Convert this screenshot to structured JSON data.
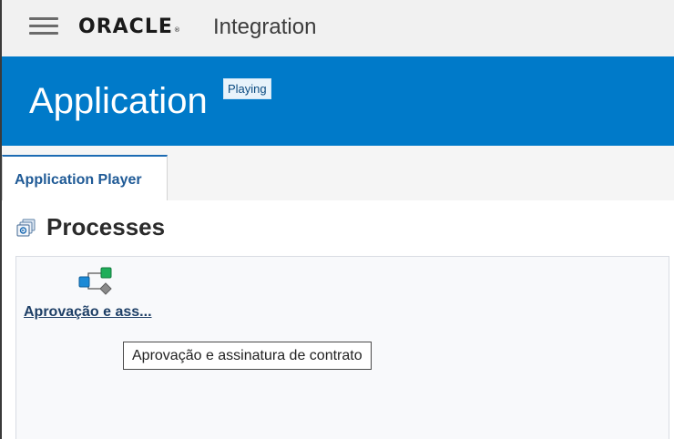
{
  "header": {
    "menu_icon": "hamburger-menu-icon",
    "brand": "ORACLE",
    "brand_mark": "®",
    "product": "Integration"
  },
  "banner": {
    "title": "Application",
    "status_badge": "Playing",
    "color": "#007ac9"
  },
  "tabs": [
    {
      "label": "Application Player",
      "active": true
    }
  ],
  "processes": {
    "title": "Processes",
    "icon": "processes-stack-icon",
    "items": [
      {
        "label": "Aprovação e ass...",
        "icon": "process-flow-icon",
        "tooltip": "Aprovação e assinatura de contrato"
      }
    ]
  },
  "colors": {
    "accent": "#1c6bb3",
    "link": "#1e3f66",
    "flow_start": "#1c8ad6",
    "flow_end": "#1fae5a",
    "flow_gateway": "#8a8a8a"
  }
}
